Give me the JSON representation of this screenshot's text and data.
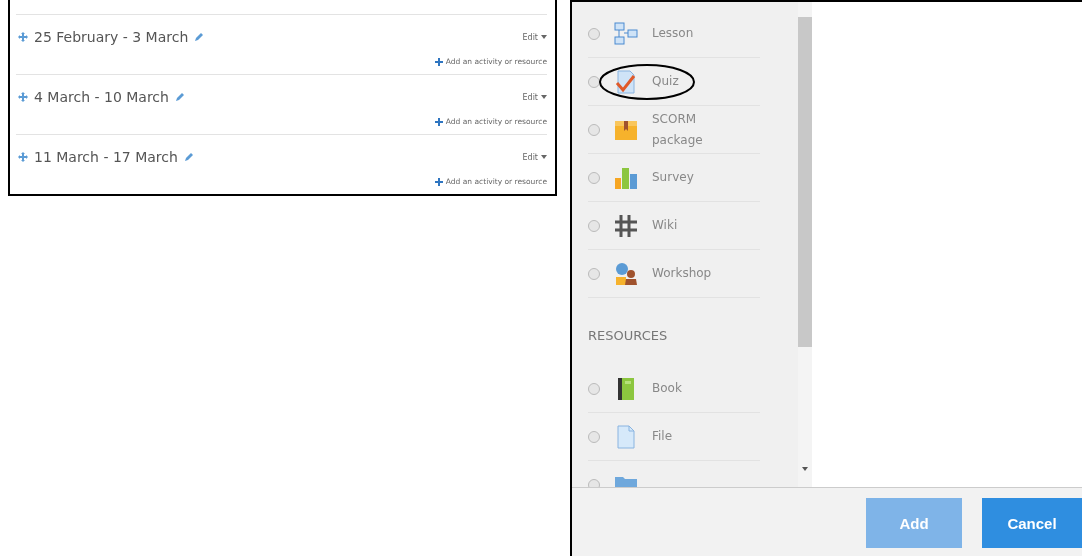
{
  "sections": [
    {
      "title": "25 February - 3 March",
      "edit": "Edit",
      "add_link": "Add an activity or resource"
    },
    {
      "title": "4 March - 10 March",
      "edit": "Edit",
      "add_link": "Add an activity or resource"
    },
    {
      "title": "11 March - 17 March",
      "edit": "Edit",
      "add_link": "Add an activity or resource"
    }
  ],
  "chooser": {
    "activities": [
      {
        "label": "Lesson",
        "kind": "lesson",
        "selected": false,
        "circled": false
      },
      {
        "label": "Quiz",
        "kind": "quiz",
        "selected": false,
        "circled": true
      },
      {
        "label": "SCORM package",
        "kind": "package",
        "selected": false,
        "circled": false
      },
      {
        "label": "Survey",
        "kind": "survey",
        "selected": false,
        "circled": false
      },
      {
        "label": "Wiki",
        "kind": "wiki",
        "selected": false,
        "circled": false
      },
      {
        "label": "Workshop",
        "kind": "workshop",
        "selected": false,
        "circled": false
      }
    ],
    "resources_heading": "RESOURCES",
    "resources": [
      {
        "label": "Book",
        "kind": "book",
        "selected": false,
        "circled": false
      },
      {
        "label": "File",
        "kind": "file",
        "selected": false,
        "circled": false
      },
      {
        "kind": "folder",
        "selected": false,
        "circled": false
      }
    ],
    "buttons": [
      {
        "label": "Add",
        "disabled": true
      },
      {
        "label": "Cancel",
        "disabled": false
      }
    ]
  }
}
